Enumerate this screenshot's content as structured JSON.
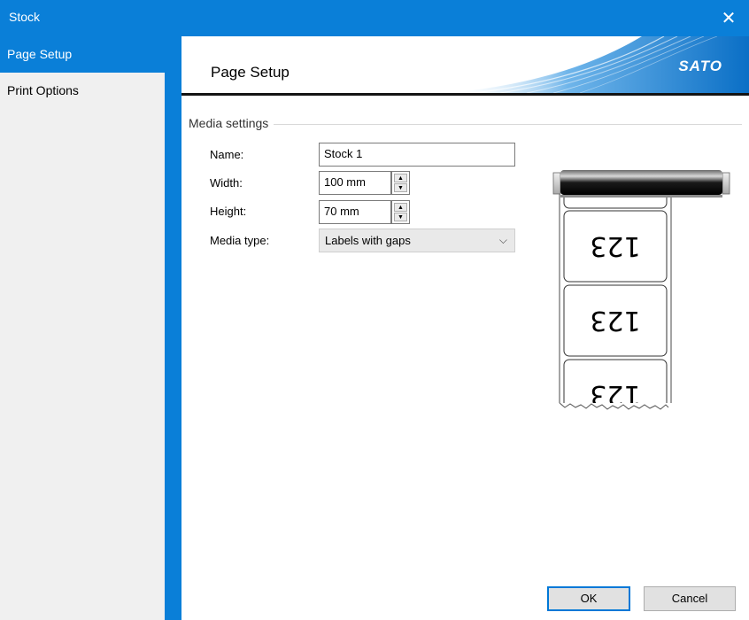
{
  "window": {
    "title": "Stock",
    "close_glyph": "✕"
  },
  "sidebar": {
    "items": [
      {
        "label": "Page Setup",
        "selected": true
      },
      {
        "label": "Print Options",
        "selected": false
      }
    ]
  },
  "header": {
    "title": "Page Setup",
    "logo_text": "SATO"
  },
  "media_settings": {
    "group_label": "Media settings",
    "name": {
      "label": "Name:",
      "value": "Stock 1"
    },
    "width": {
      "label": "Width:",
      "value": "100 mm"
    },
    "height": {
      "label": "Height:",
      "value": "70 mm"
    },
    "media_type": {
      "label": "Media type:",
      "value": "Labels with gaps"
    }
  },
  "preview": {
    "label_text": "123"
  },
  "buttons": {
    "ok": "OK",
    "cancel": "Cancel"
  },
  "colors": {
    "accent": "#0a7fd8",
    "banner_swoosh": "#1e88d8"
  }
}
